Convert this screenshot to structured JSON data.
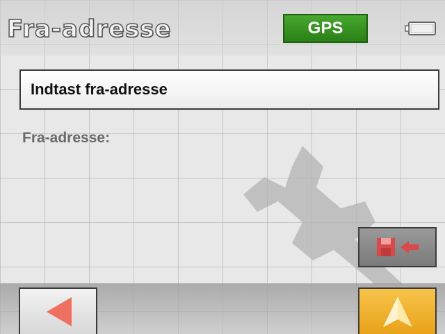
{
  "header": {
    "title": "Fra-adresse",
    "gps_label": "GPS",
    "gps_color": "#3c9a25",
    "battery_icon": "battery-icon"
  },
  "input": {
    "label": "Indtast fra-adresse"
  },
  "field": {
    "label": "Fra-adresse:"
  },
  "watermark": {
    "icon": "wrench-icon"
  },
  "actions": {
    "save_icon": "save-arrow-icon",
    "save_color": "#d84a4a"
  },
  "bottom_bar": {
    "back_icon": "left-arrow-icon",
    "back_color": "#f07060",
    "navigate_icon": "navigation-arrow-icon",
    "navigate_color": "#f2b632"
  }
}
